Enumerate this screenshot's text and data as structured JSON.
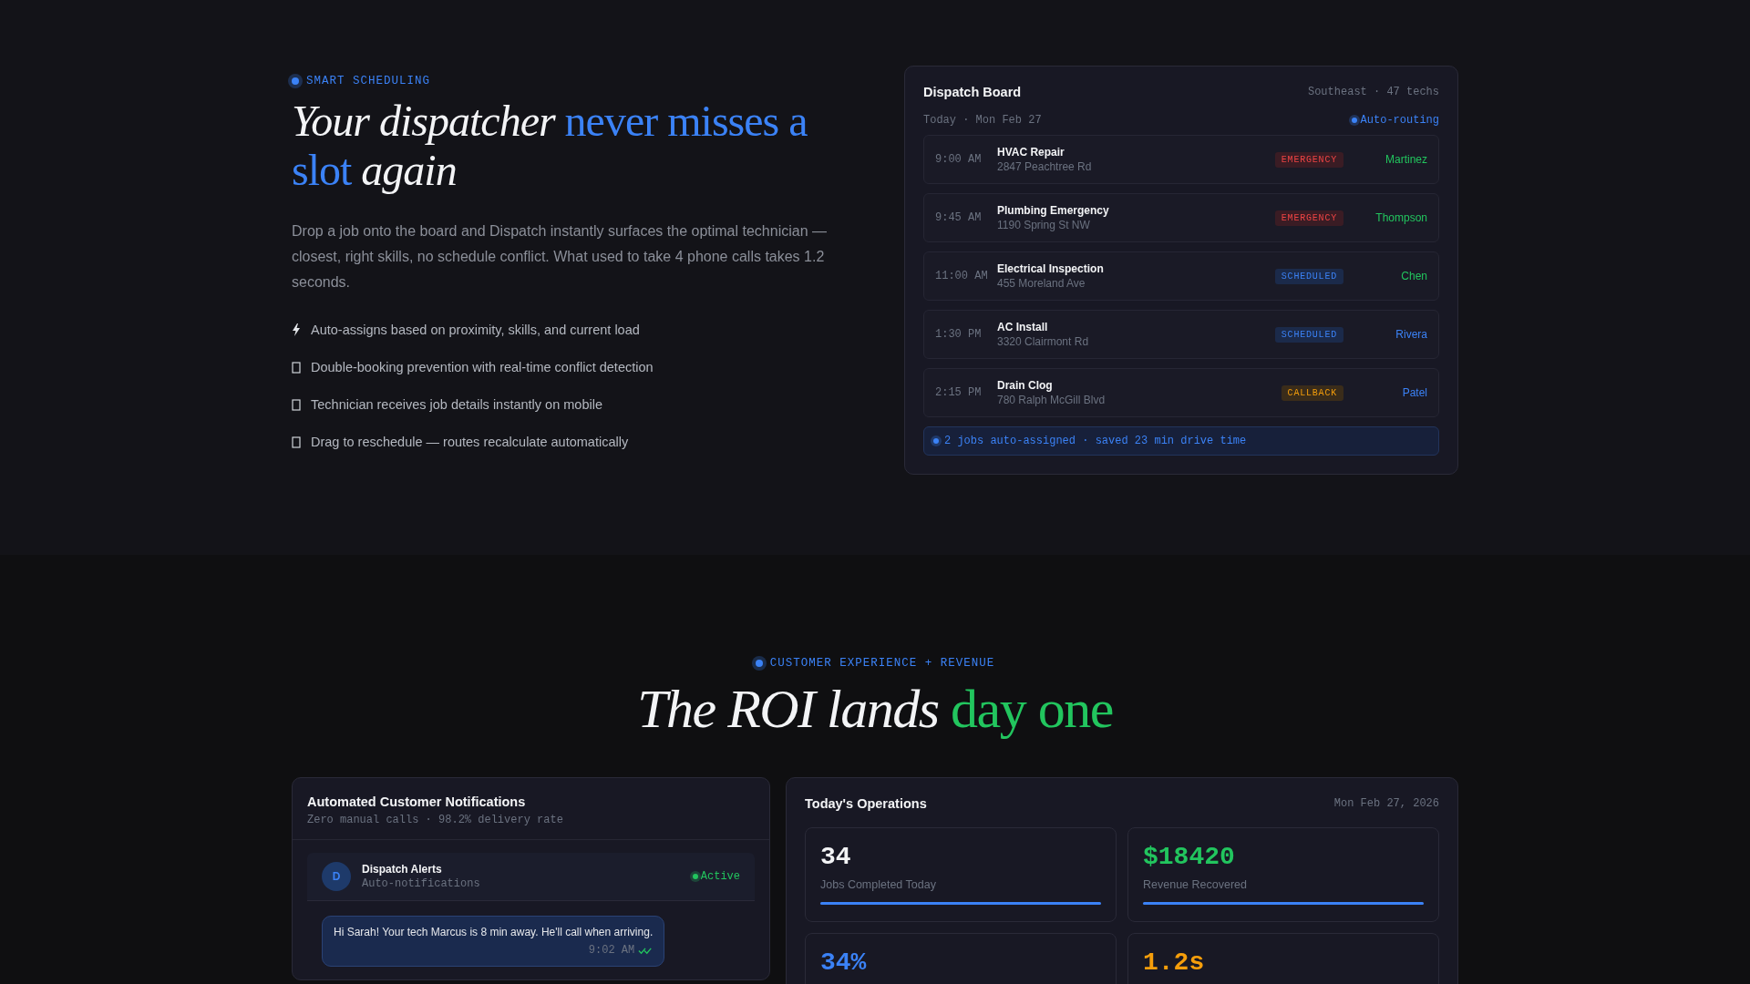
{
  "hero": {
    "eyebrow": "SMART SCHEDULING",
    "headline": [
      {
        "text": "Your dispatcher",
        "highlighted": false
      },
      {
        "text": "never misses a slot",
        "highlighted": true
      },
      {
        "text": "again",
        "highlighted": false
      }
    ],
    "description": "Drop a job onto the board and Dispatch instantly surfaces the optimal technician — closest, right skills, no schedule conflict. What used to take 4 phone calls takes 1.2 seconds.",
    "features": [
      {
        "kind": "bolt",
        "text": "Auto-assigns based on proximity, skills, and current load"
      },
      {
        "kind": "missing-glyph",
        "text": "Double-booking prevention with real-time conflict detection"
      },
      {
        "kind": "missing-glyph",
        "text": "Technician receives job details instantly on mobile"
      },
      {
        "kind": "missing-glyph",
        "text": "Drag to reschedule — routes recalculate automatically"
      }
    ]
  },
  "dispatch_board": {
    "title": "Dispatch Board",
    "region": "Southeast · 47 techs",
    "date": "Today · Mon Feb 27",
    "mode": "Auto-routing",
    "jobs": [
      {
        "time": "9:00 AM",
        "title": "HVAC Repair",
        "address": "2847 Peachtree Rd",
        "status": "EMERGENCY",
        "kind": "emergency",
        "tech": "Martinez",
        "color": "#22c55e"
      },
      {
        "time": "9:45 AM",
        "title": "Plumbing Emergency",
        "address": "1190 Spring St NW",
        "status": "EMERGENCY",
        "kind": "emergency",
        "tech": "Thompson",
        "color": "#22c55e"
      },
      {
        "time": "11:00 AM",
        "title": "Electrical Inspection",
        "address": "455 Moreland Ave",
        "status": "SCHEDULED",
        "kind": "scheduled",
        "tech": "Chen",
        "color": "#22c55e"
      },
      {
        "time": "1:30 PM",
        "title": "AC Install",
        "address": "3320 Clairmont Rd",
        "status": "SCHEDULED",
        "kind": "scheduled",
        "tech": "Rivera",
        "color": "#3b82f6"
      },
      {
        "time": "2:15 PM",
        "title": "Drain Clog",
        "address": "780 Ralph McGill Blvd",
        "status": "CALLBACK",
        "kind": "callback",
        "tech": "Patel",
        "color": "#3b82f6"
      }
    ],
    "footer": "2 jobs auto-assigned · saved 23 min drive time"
  },
  "roi": {
    "eyebrow": "CUSTOMER EXPERIENCE + REVENUE",
    "headline": [
      {
        "text": "The ROI lands",
        "highlighted": false
      },
      {
        "text": "day one",
        "highlighted": true
      }
    ],
    "kind": "roi"
  },
  "notifications": {
    "title": "Automated Customer Notifications",
    "subtitle": "Zero manual calls · 98.2% delivery rate",
    "sender": {
      "initial": "D",
      "name": "Dispatch Alerts",
      "subtitle": "Auto-notifications",
      "status": "Active"
    },
    "messages": [
      {
        "text": "Hi Sarah! Your tech Marcus is 8 min away. He'll call when arriving.",
        "time": "9:02 AM",
        "delivered": true
      }
    ]
  },
  "operations": {
    "title": "Today's Operations",
    "date": "Mon Feb 27, 2026",
    "stats": [
      {
        "value": "34",
        "label": "Jobs Completed Today",
        "level": 1,
        "color": "#f3f4f6"
      },
      {
        "value": "$18420",
        "label": "Revenue Recovered",
        "level": 1,
        "color": "#22c55e"
      },
      {
        "value": "34%",
        "color": "#3b82f6"
      },
      {
        "value": "1.2s",
        "color": "#f59e0b"
      }
    ]
  }
}
